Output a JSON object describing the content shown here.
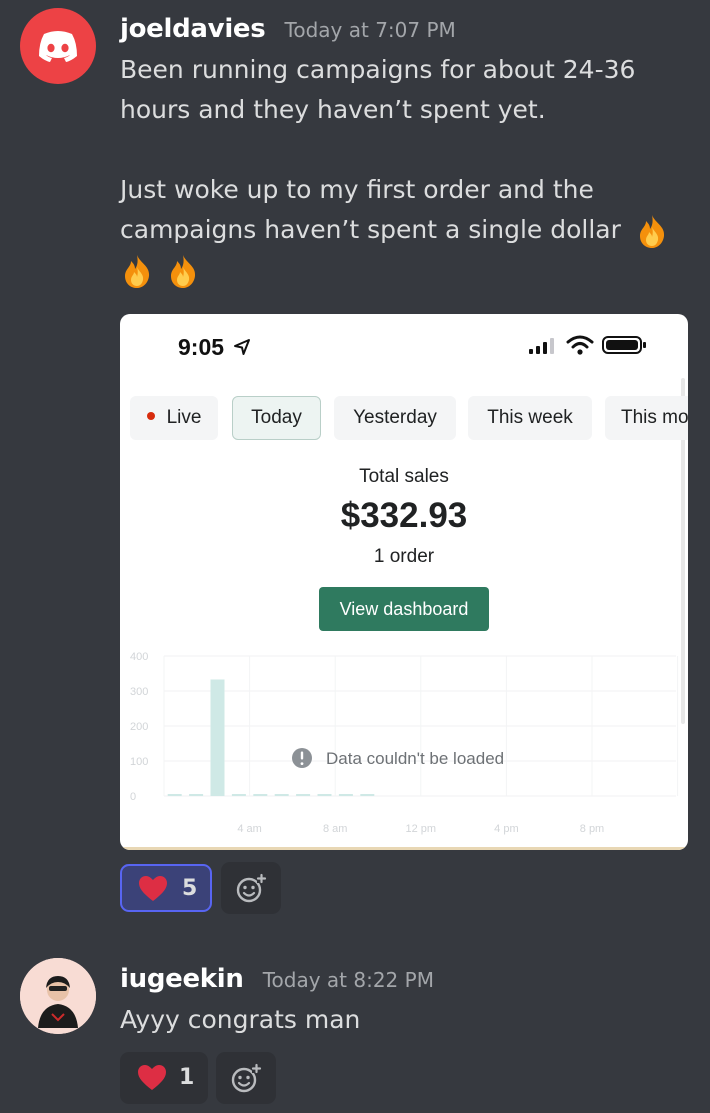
{
  "messages": [
    {
      "username": "joeldavies",
      "timestamp": "Today at 7:07 PM",
      "lines": [
        "Been running campaigns for about 24-36",
        "hours and they haven’t spent yet.",
        "",
        "Just woke up to my first order and the",
        "campaigns haven’t spent a single dollar"
      ],
      "emoji": [
        "fire",
        "fire",
        "fire"
      ],
      "attachment": {
        "status_time": "9:05",
        "tabs": [
          "Live",
          "Today",
          "Yesterday",
          "This week",
          "This mo"
        ],
        "active_tab": "Today",
        "total_label": "Total sales",
        "total_value": "$332.93",
        "orders": "1 order",
        "button": "View dashboard",
        "error": "Data couldn't be loaded",
        "chart_data": {
          "type": "bar",
          "x": [
            "12 am",
            "1 am",
            "2 am",
            "3 am",
            "4 am",
            "5 am",
            "6 am",
            "7 am",
            "8 am",
            "9 am"
          ],
          "values": [
            0,
            0,
            332.93,
            0,
            0,
            0,
            0,
            0,
            0,
            0
          ],
          "yticks": [
            "400",
            "300",
            "200",
            "100",
            "0"
          ],
          "xticks": [
            "4 am",
            "8 am",
            "12 pm",
            "4 pm",
            "8 pm"
          ],
          "ylim": [
            0,
            400
          ],
          "bar_color": "#cfe9e6"
        }
      },
      "reactions": [
        {
          "emoji": "heart",
          "count": "5",
          "me": true
        }
      ]
    },
    {
      "username": "iugeekin",
      "timestamp": "Today at 8:22 PM",
      "text": "Ayyy congrats man",
      "reactions": [
        {
          "emoji": "heart",
          "count": "1",
          "me": false
        }
      ]
    }
  ],
  "colors": {
    "background": "#36393f",
    "discord_red": "#ed4245",
    "blurple": "#5865f2",
    "shopify_green": "#2f7a5f"
  }
}
